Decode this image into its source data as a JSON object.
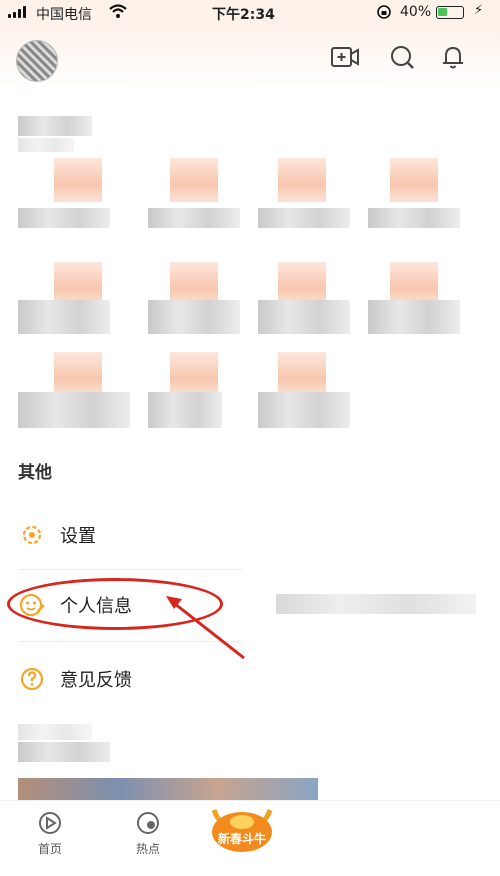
{
  "status_bar": {
    "carrier": "中国电信",
    "time": "下午2:34",
    "battery_percent": "40%",
    "battery_level": 0.4
  },
  "header": {
    "icons": [
      "video-add-icon",
      "search-icon",
      "bell-icon"
    ]
  },
  "sections": {
    "other_title": "其他"
  },
  "menu": {
    "settings_label": "设置",
    "profile_label": "个人信息",
    "feedback_label": "意见反馈"
  },
  "tabbar": {
    "home_label": "首页",
    "hot_label": "热点",
    "promo_label": "新春斗牛"
  },
  "colors": {
    "accent": "#f5a623",
    "highlight_circle": "#d9261c",
    "battery_fill": "#46c657"
  }
}
